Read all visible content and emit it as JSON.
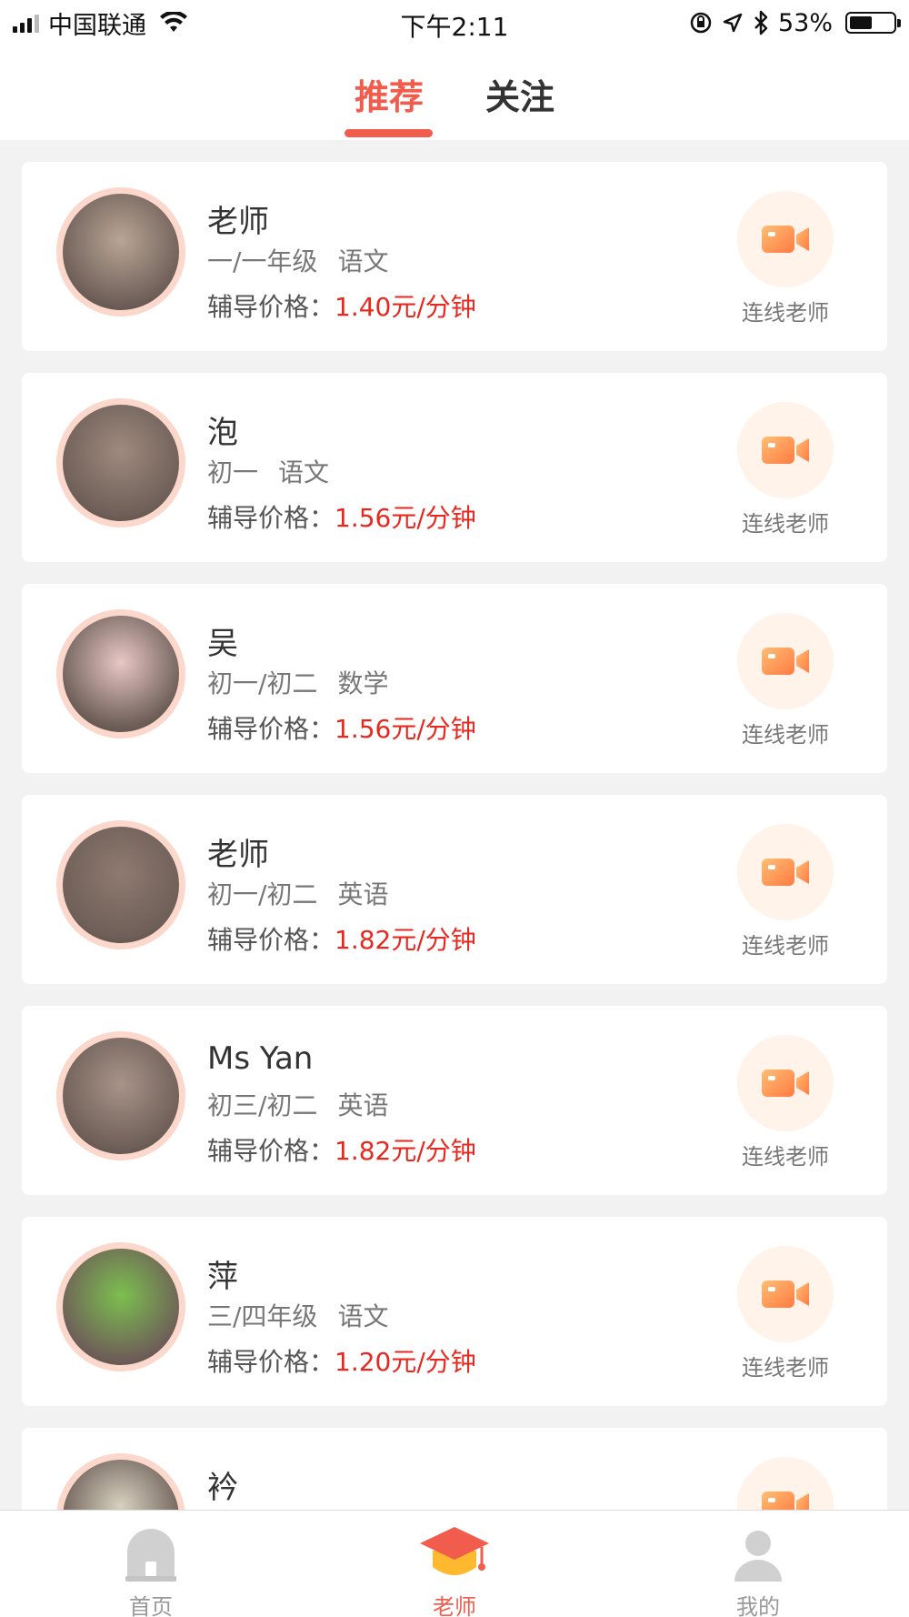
{
  "status_bar": {
    "carrier": "中国联通",
    "time": "下午2:11",
    "battery_text": "53%",
    "battery_level": 0.53
  },
  "tabs": [
    {
      "label": "推荐",
      "active": true
    },
    {
      "label": "关注",
      "active": false
    }
  ],
  "colors": {
    "accent": "#f25c4d",
    "price": "#e8281f",
    "camera_gradient_start": "#ffbf73",
    "camera_gradient_end": "#ff7a43"
  },
  "price_label": "辅导价格：",
  "connect_label": "连线老师",
  "teachers": [
    {
      "name": "老师",
      "grade": "一/一年级",
      "subject": "语文",
      "price": "1.40元/分钟"
    },
    {
      "name": "泡",
      "grade": "初一",
      "subject": "语文",
      "price": "1.56元/分钟"
    },
    {
      "name": "吴",
      "grade": "初一/初二",
      "subject": "数学",
      "price": "1.56元/分钟"
    },
    {
      "name": "老师",
      "grade": "初一/初二",
      "subject": "英语",
      "price": "1.82元/分钟"
    },
    {
      "name": "Ms Yan",
      "grade": "初三/初二",
      "subject": "英语",
      "price": "1.82元/分钟"
    },
    {
      "name": "萍",
      "grade": "三/四年级",
      "subject": "语文",
      "price": "1.20元/分钟"
    },
    {
      "name": "衿",
      "grade": "",
      "subject": "",
      "price": ""
    }
  ],
  "bottom_nav": [
    {
      "label": "首页",
      "icon": "home-icon",
      "active": false
    },
    {
      "label": "老师",
      "icon": "graduation-cap-icon",
      "active": true
    },
    {
      "label": "我的",
      "icon": "profile-icon",
      "active": false
    }
  ]
}
